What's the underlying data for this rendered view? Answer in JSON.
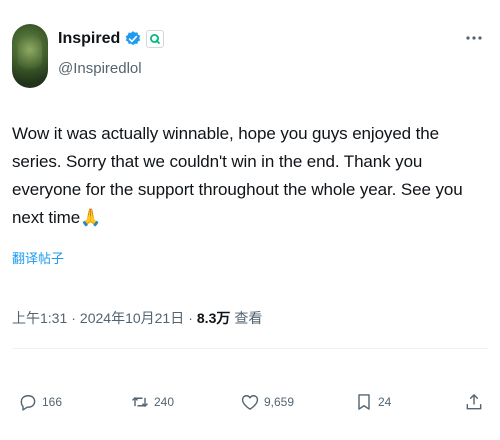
{
  "author": {
    "display_name": "Inspired",
    "handle": "@Inspiredlol",
    "verified": true,
    "affiliate_badge": "Q"
  },
  "tweet": {
    "text": "Wow it was actually winnable, hope you guys enjoyed the series. Sorry that we couldn't win in the end. Thank you everyone for the support throughout the whole year. See you next time",
    "emoji": "🙏",
    "translate_label": "翻译帖子"
  },
  "meta": {
    "time": "上午1:31",
    "sep1": "·",
    "date": "2024年10月21日",
    "sep2": "·",
    "views_count": "8.3万",
    "views_label": "查看"
  },
  "actions": {
    "replies": "166",
    "reposts": "240",
    "likes": "9,659",
    "bookmarks": "24"
  },
  "colors": {
    "accent": "#1d9bf0",
    "text_primary": "#0f1419",
    "text_secondary": "#536471",
    "verified": "#1d9bf0",
    "affiliate": "#00ba7c"
  },
  "icons": {
    "more": "more-horizontal-icon",
    "reply": "reply-icon",
    "repost": "repost-icon",
    "like": "heart-icon",
    "bookmark": "bookmark-icon",
    "share": "share-icon"
  }
}
